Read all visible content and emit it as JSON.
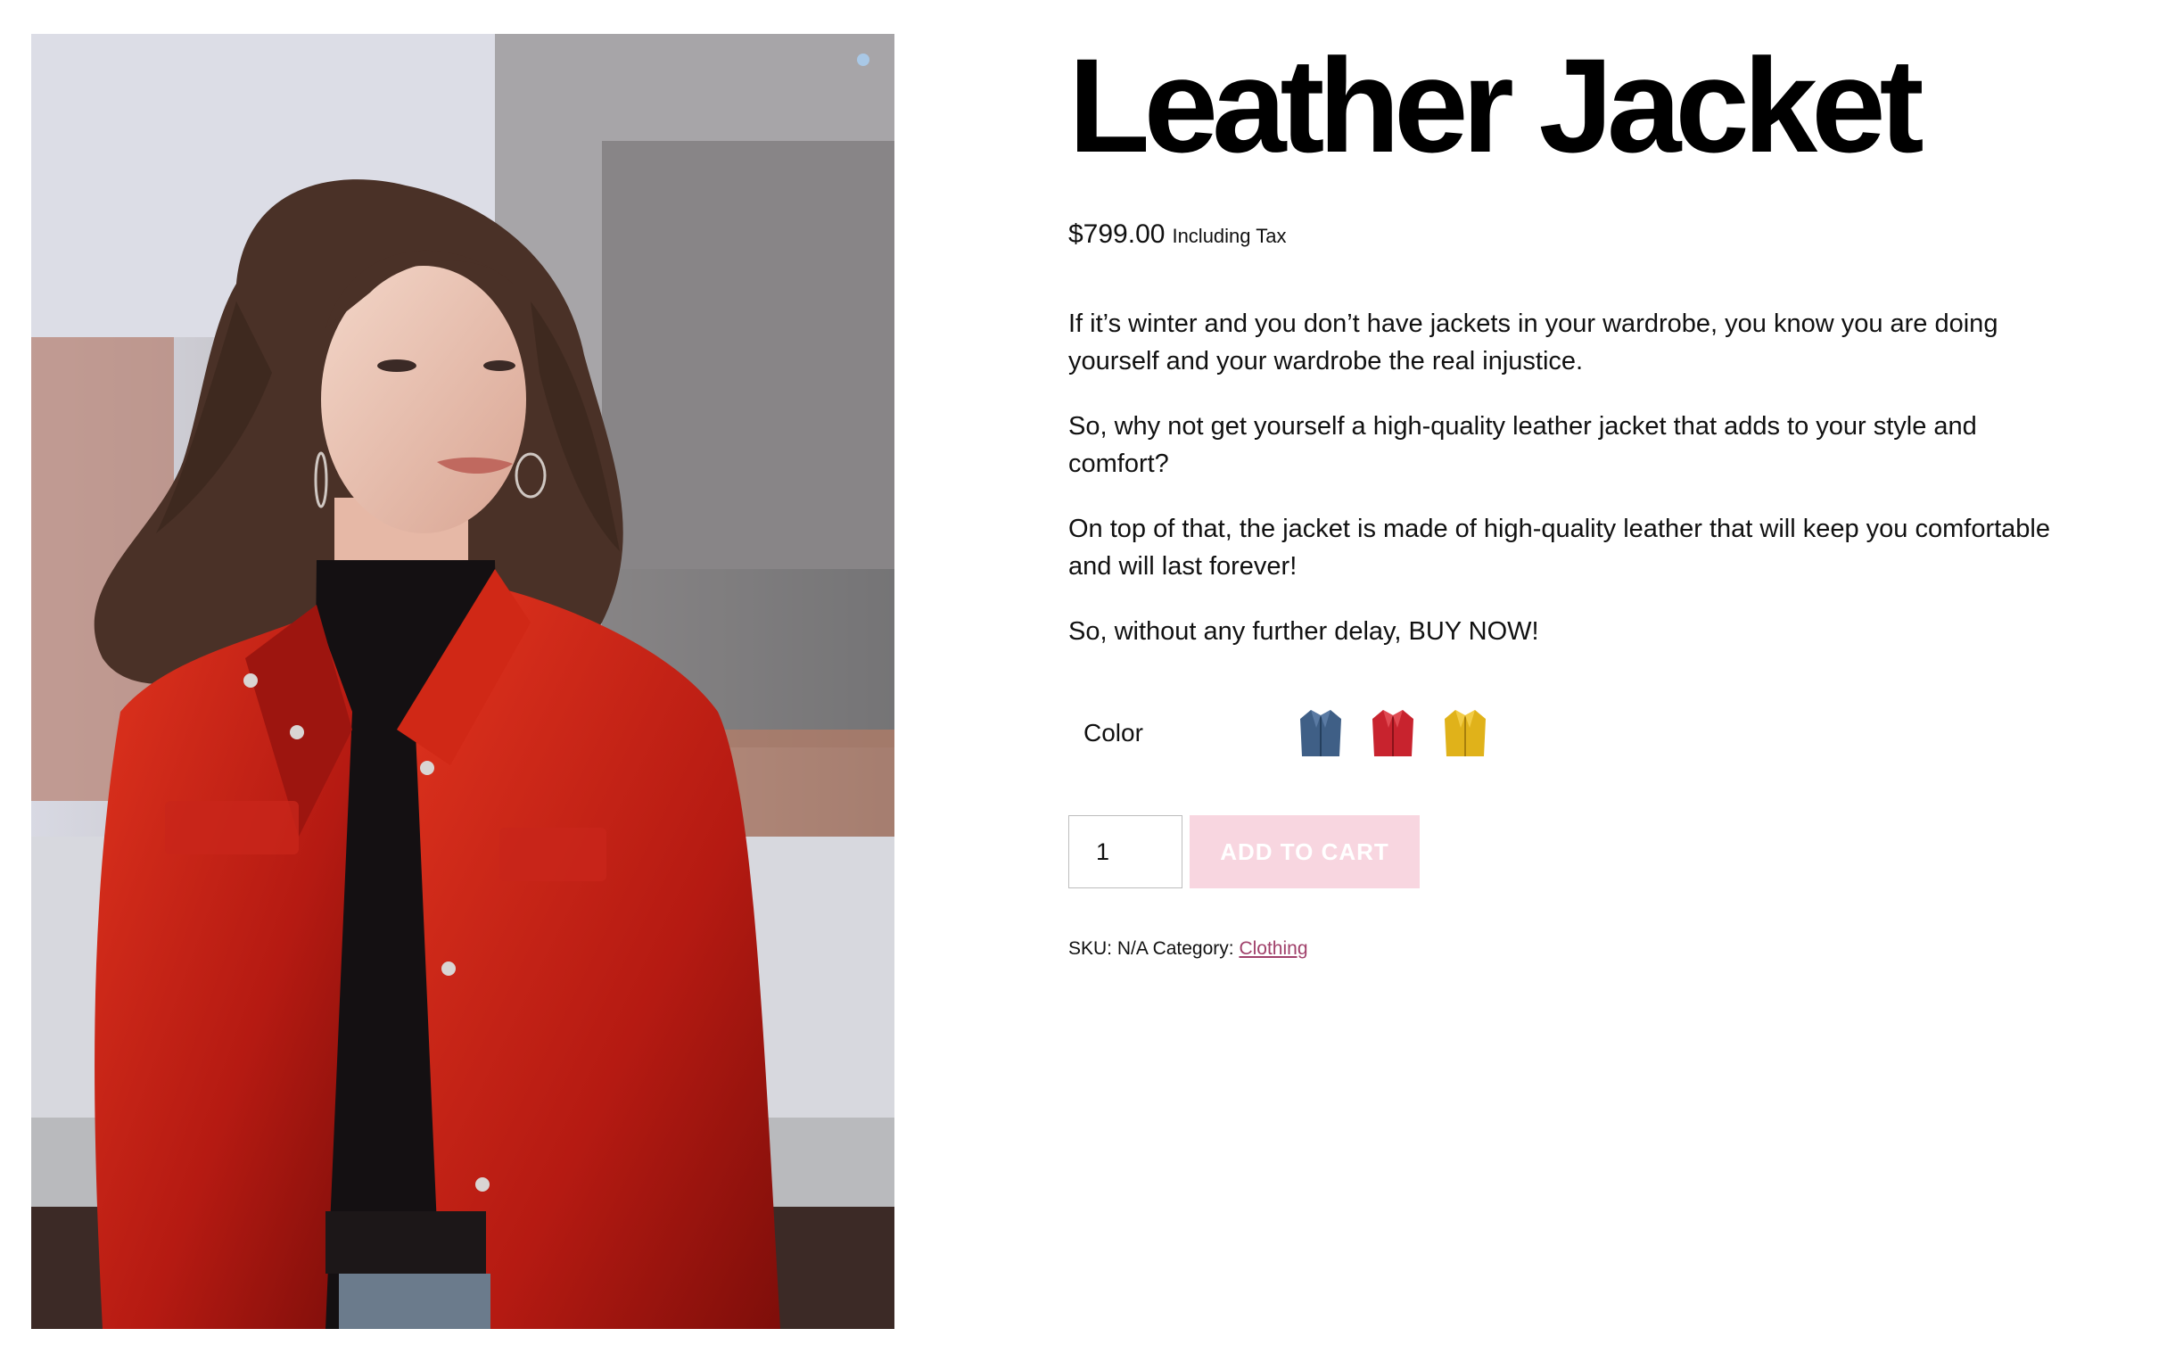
{
  "product": {
    "title": "Leather Jacket",
    "price": "$799.00",
    "tax_label": "Including Tax",
    "description": [
      "If it’s winter and you don’t have jackets in your wardrobe, you know you are doing yourself and your wardrobe the real injustice.",
      "So, why not get yourself a high-quality leather jacket that adds to your style and comfort?",
      "On top of that, the jacket is made of high-quality leather that will keep you comfortable and will last forever!",
      "So, without any further delay, BUY NOW!"
    ],
    "image_icon": "product-photo-woman-red-leather-jacket"
  },
  "variations": {
    "color_label": "Color",
    "swatches": [
      {
        "icon": "blue-jacket-swatch",
        "color": "#3f5f86"
      },
      {
        "icon": "red-jacket-swatch",
        "color": "#c8232e"
      },
      {
        "icon": "yellow-jacket-swatch",
        "color": "#e0b21a"
      }
    ]
  },
  "cart": {
    "quantity": "1",
    "add_to_cart_label": "ADD TO CART",
    "button_color": "#f8d6e0"
  },
  "meta": {
    "sku_label": "SKU:",
    "sku_value": "N/A",
    "category_label": "Category:",
    "category_value": "Clothing",
    "link_color": "#a0406a"
  }
}
